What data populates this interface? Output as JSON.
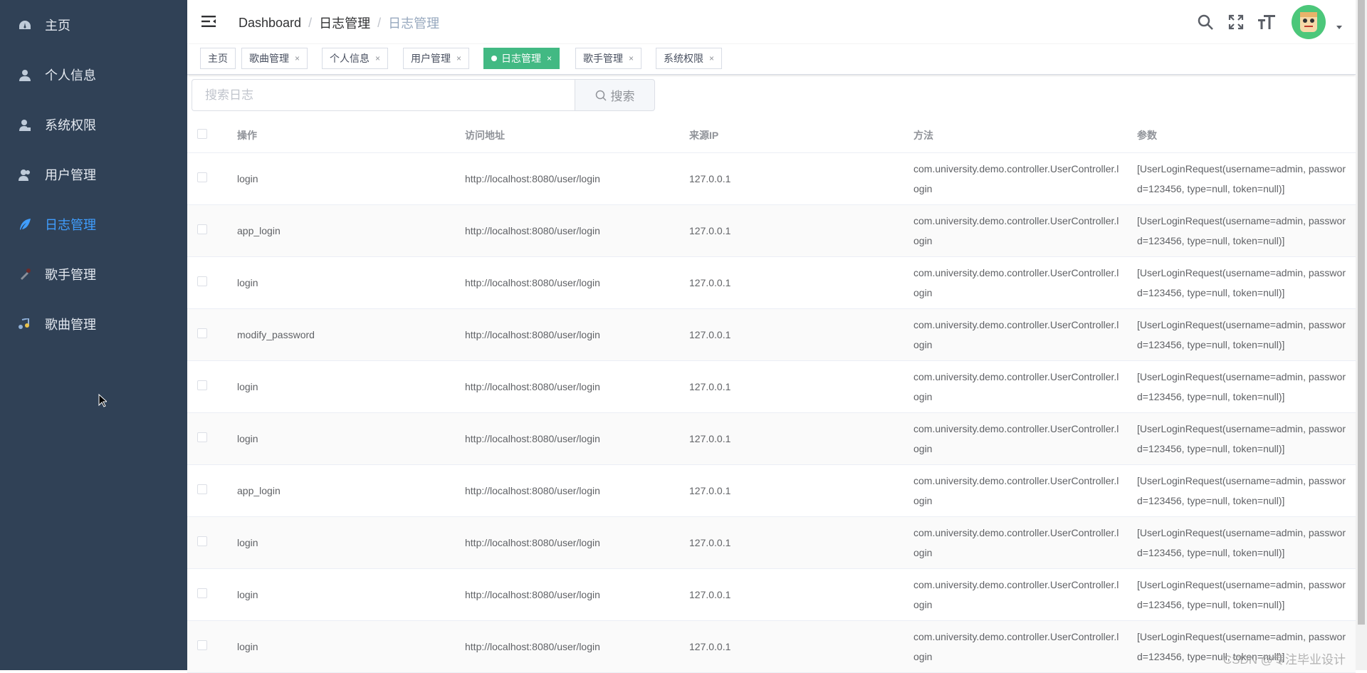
{
  "sidebar": {
    "items": [
      {
        "label": "主页",
        "icon": "dashboard-icon",
        "active": false
      },
      {
        "label": "个人信息",
        "icon": "user-icon",
        "active": false
      },
      {
        "label": "系统权限",
        "icon": "user-lock-icon",
        "active": false
      },
      {
        "label": "用户管理",
        "icon": "users-icon",
        "active": false
      },
      {
        "label": "日志管理",
        "icon": "feather-icon",
        "active": true
      },
      {
        "label": "歌手管理",
        "icon": "microphone-icon",
        "active": false
      },
      {
        "label": "歌曲管理",
        "icon": "music-icon",
        "active": false
      }
    ],
    "active_color": "#409eff",
    "bg_color": "#304156"
  },
  "navbar": {
    "breadcrumb": [
      "Dashboard",
      "日志管理",
      "日志管理"
    ],
    "breadcrumb_sep": "/",
    "icons": [
      "search-icon",
      "fullscreen-icon",
      "font-size-icon"
    ]
  },
  "tags": [
    {
      "label": "主页",
      "closable": false,
      "active": false
    },
    {
      "label": "歌曲管理",
      "closable": true,
      "active": false
    },
    {
      "label": "个人信息",
      "closable": true,
      "active": false
    },
    {
      "label": "用户管理",
      "closable": true,
      "active": false
    },
    {
      "label": "日志管理",
      "closable": true,
      "active": true
    },
    {
      "label": "歌手管理",
      "closable": true,
      "active": false
    },
    {
      "label": "系统权限",
      "closable": true,
      "active": false
    }
  ],
  "tag_close_glyph": "×",
  "tag_active_color": "#42b983",
  "search": {
    "placeholder": "搜索日志",
    "value": "",
    "button_label": "搜索"
  },
  "table": {
    "headers": [
      "操作",
      "访问地址",
      "来源IP",
      "方法",
      "参数"
    ],
    "rows": [
      {
        "op": "login",
        "url": "http://localhost:8080/user/login",
        "ip": "127.0.0.1",
        "method": "com.university.demo.controller.UserController.login",
        "param": "[UserLoginRequest(username=admin, password=123456, type=null, token=null)]"
      },
      {
        "op": "app_login",
        "url": "http://localhost:8080/user/login",
        "ip": "127.0.0.1",
        "method": "com.university.demo.controller.UserController.login",
        "param": "[UserLoginRequest(username=admin, password=123456, type=null, token=null)]"
      },
      {
        "op": "login",
        "url": "http://localhost:8080/user/login",
        "ip": "127.0.0.1",
        "method": "com.university.demo.controller.UserController.login",
        "param": "[UserLoginRequest(username=admin, password=123456, type=null, token=null)]"
      },
      {
        "op": "modify_password",
        "url": "http://localhost:8080/user/login",
        "ip": "127.0.0.1",
        "method": "com.university.demo.controller.UserController.login",
        "param": "[UserLoginRequest(username=admin, password=123456, type=null, token=null)]"
      },
      {
        "op": "login",
        "url": "http://localhost:8080/user/login",
        "ip": "127.0.0.1",
        "method": "com.university.demo.controller.UserController.login",
        "param": "[UserLoginRequest(username=admin, password=123456, type=null, token=null)]"
      },
      {
        "op": "login",
        "url": "http://localhost:8080/user/login",
        "ip": "127.0.0.1",
        "method": "com.university.demo.controller.UserController.login",
        "param": "[UserLoginRequest(username=admin, password=123456, type=null, token=null)]"
      },
      {
        "op": "app_login",
        "url": "http://localhost:8080/user/login",
        "ip": "127.0.0.1",
        "method": "com.university.demo.controller.UserController.login",
        "param": "[UserLoginRequest(username=admin, password=123456, type=null, token=null)]"
      },
      {
        "op": "login",
        "url": "http://localhost:8080/user/login",
        "ip": "127.0.0.1",
        "method": "com.university.demo.controller.UserController.login",
        "param": "[UserLoginRequest(username=admin, password=123456, type=null, token=null)]"
      },
      {
        "op": "login",
        "url": "http://localhost:8080/user/login",
        "ip": "127.0.0.1",
        "method": "com.university.demo.controller.UserController.login",
        "param": "[UserLoginRequest(username=admin, password=123456, type=null, token=null)]"
      },
      {
        "op": "login",
        "url": "http://localhost:8080/user/login",
        "ip": "127.0.0.1",
        "method": "com.university.demo.controller.UserController.login",
        "param": "[UserLoginRequest(username=admin, password=123456, type=null, token=null)]"
      }
    ]
  },
  "watermark": "CSDN @专注毕业设计"
}
